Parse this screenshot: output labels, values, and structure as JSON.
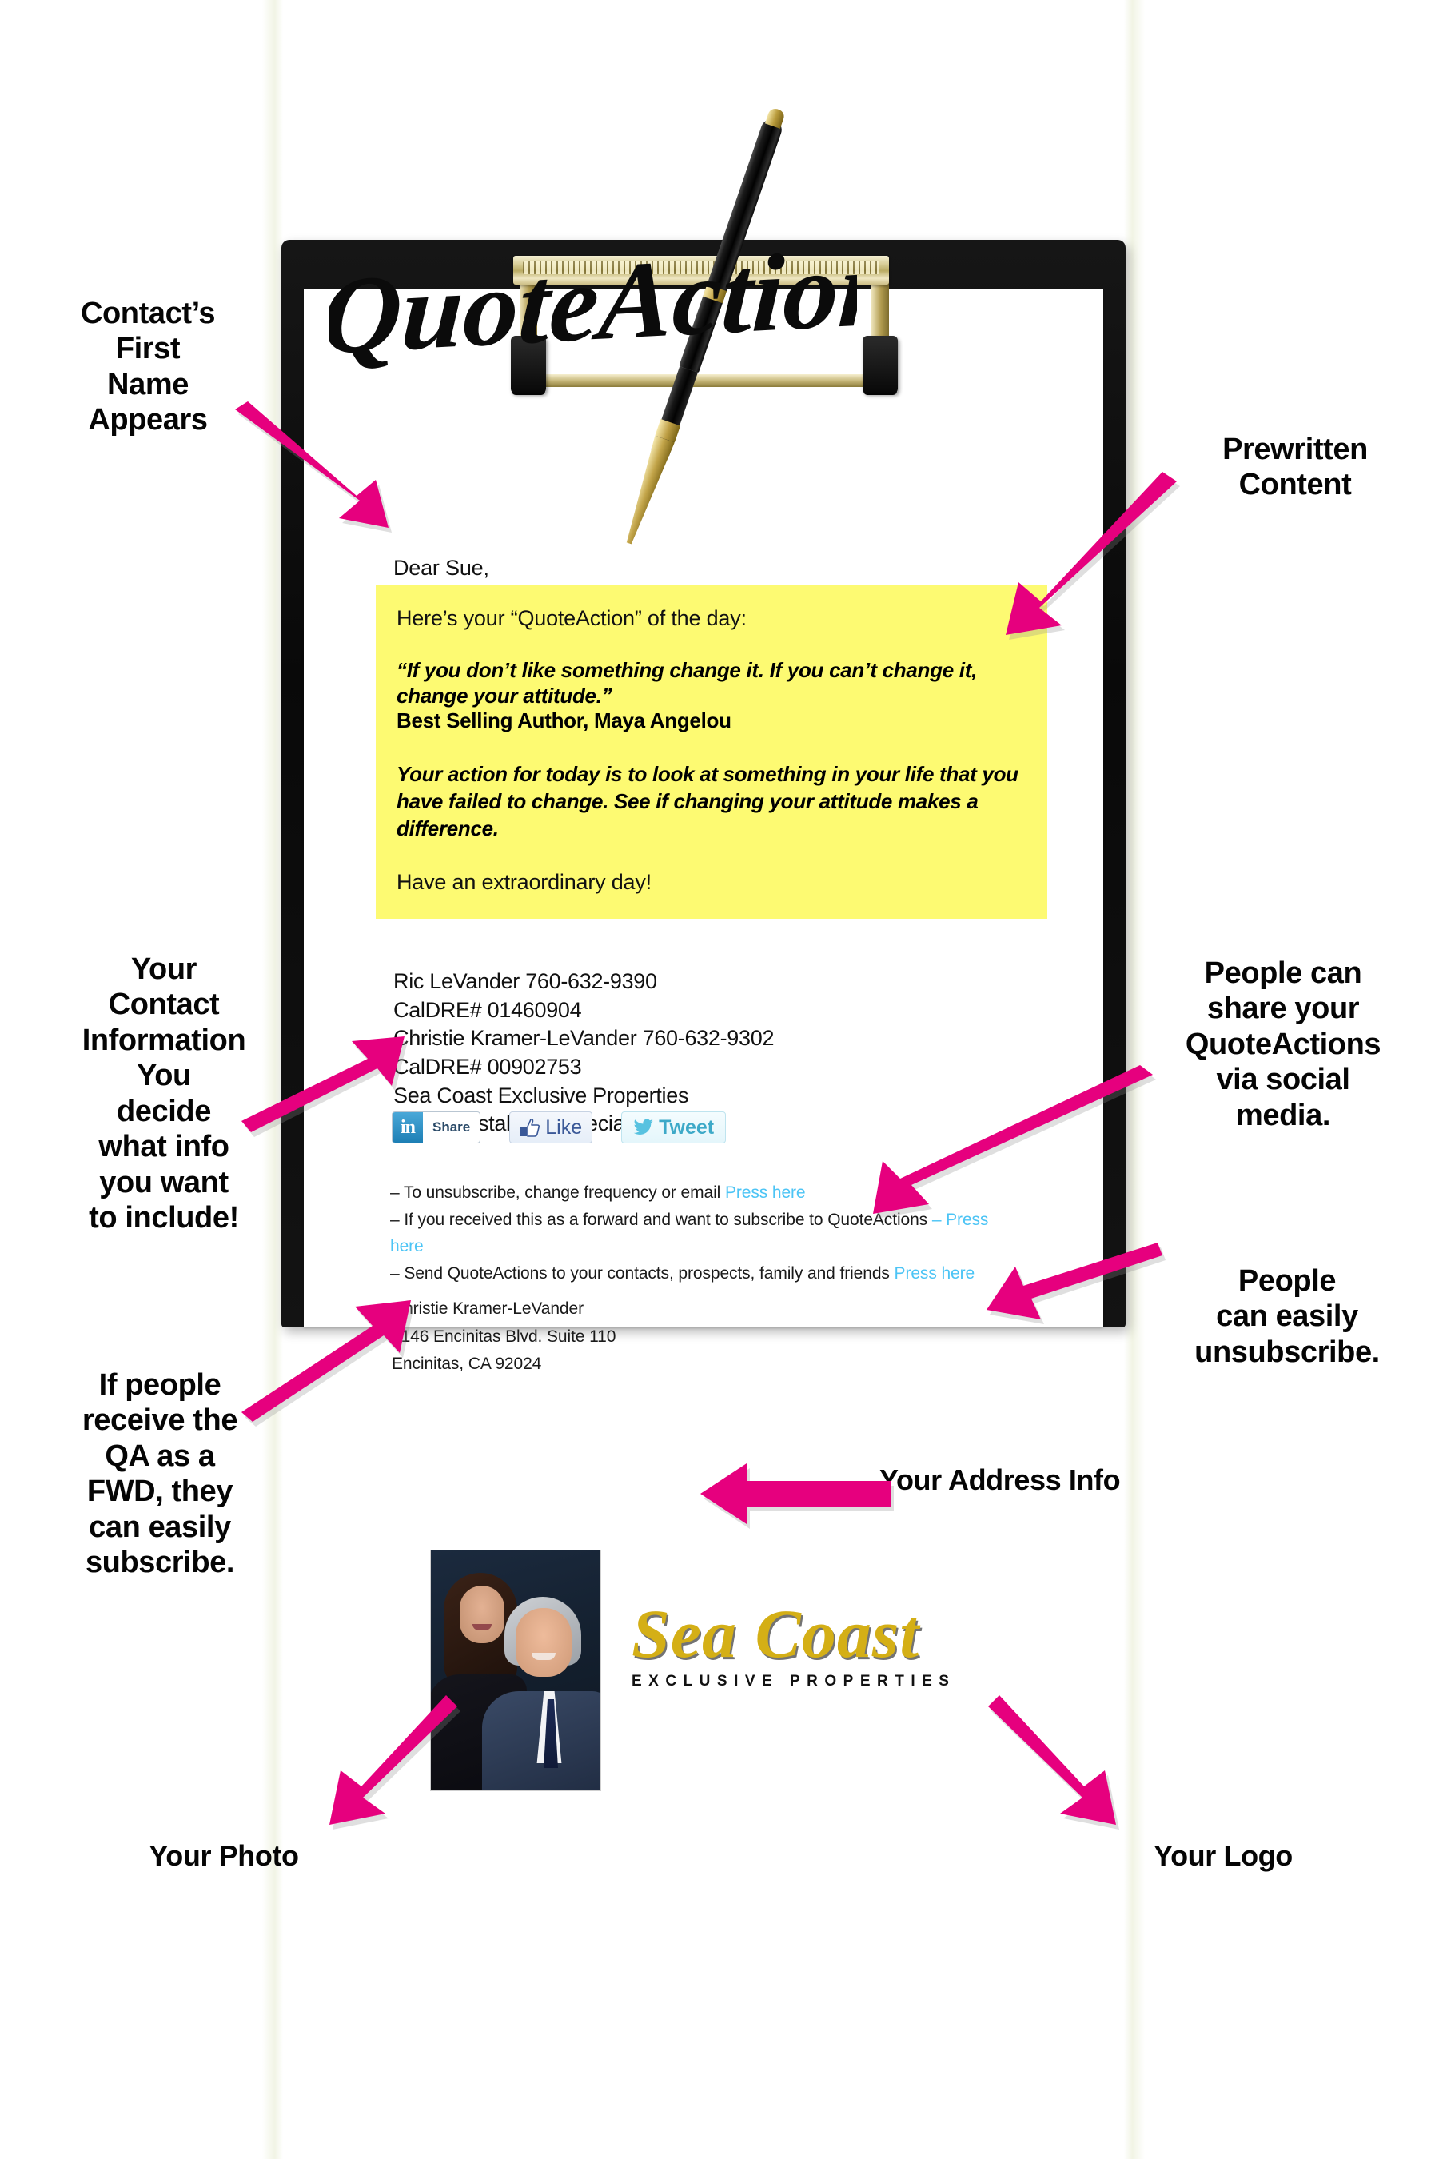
{
  "email": {
    "brand_logo_text": "QuoteAction",
    "salutation": "Dear Sue,",
    "quote_box": {
      "intro": "Here’s your “QuoteAction” of the day:",
      "quote": "“If you don’t like something change it. If you can’t change it, change your attitude.”",
      "author": "Best Selling Author, Maya Angelou",
      "action": "Your action for today is to look at something in your life that you have failed to change. See if changing your attitude makes a difference.",
      "closing": "Have an extraordinary day!",
      "background_color": "#fdfa72"
    },
    "contact": {
      "line1": "Ric LeVander 760-632-9390",
      "line2": "CalDRE# 01460904",
      "line3": "Christie Kramer-LeVander 760-632-9302",
      "line4": "CalDRE# 00902753",
      "line5": "Sea Coast Exclusive Properties",
      "line6": "www.coastalhomespecialist.com"
    },
    "social": {
      "linkedin_icon": "linkedin-icon",
      "linkedin_mark": "in",
      "linkedin_label": "Share",
      "facebook_icon": "thumbs-up-icon",
      "facebook_label": "Like",
      "twitter_icon": "twitter-bird-icon",
      "twitter_label": "Tweet"
    },
    "links": {
      "item1_text": "– To unsubscribe, change frequency or email ",
      "item1_link": "Press here",
      "item2_text": "– If you received this as a forward and want to subscribe to QuoteActions ",
      "item2_dash": "– ",
      "item2_link": "Press here",
      "item3_text": "– Send QuoteActions to your contacts, prospects, family and friends ",
      "item3_link": "Press here",
      "link_color": "#4cc4f5"
    },
    "address": {
      "name": "Christie Kramer-LeVander",
      "street": "2146 Encinitas Blvd. Suite 110",
      "city_state_zip": "Encinitas, CA 92024"
    },
    "logo": {
      "script": "Sea Coast",
      "subtitle": "EXCLUSIVE PROPERTIES",
      "gold_color": "#d4af16"
    },
    "photo_alt": "agent-couple-headshot"
  },
  "annotations": {
    "accent_color": "#e6007e",
    "contacts_first_name": "Contact’s\nFirst\nName\nAppears",
    "prewritten_content": "Prewritten\nContent",
    "your_contact_information": "Your\nContact\nInformation\nYou\ndecide\nwhat info\nyou want\nto include!",
    "people_can_share": "People can\nshare your\nQuoteActions\nvia social\nmedia.",
    "people_can_unsubscribe": "People\ncan easily\nunsubscribe.",
    "if_people_receive_fwd": "If people\nreceive the\nQA as a\nFWD, they\ncan easily\nsubscribe.",
    "your_address_info": "Your Address Info",
    "your_photo": "Your Photo",
    "your_logo": "Your Logo"
  }
}
